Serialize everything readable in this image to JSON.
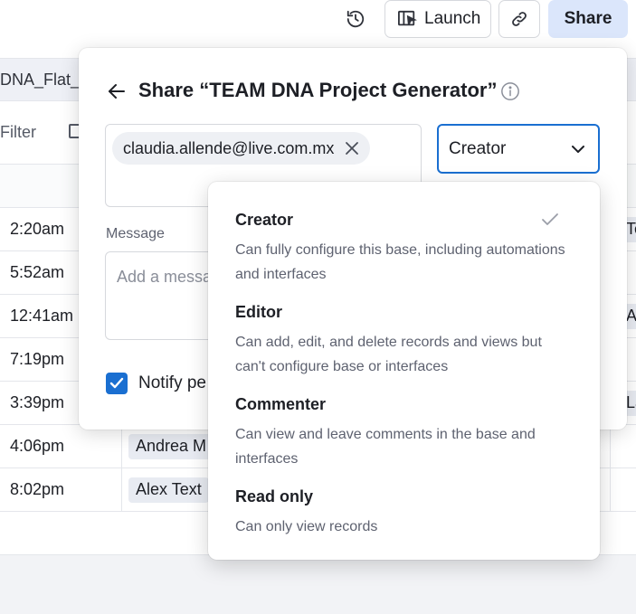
{
  "topbar": {
    "launch_label": "Launch",
    "share_label": "Share"
  },
  "background": {
    "tab_name": "DNA_Flat_",
    "filter_label": "Filter",
    "times": [
      "2:20am",
      "5:52am",
      "12:41am",
      "7:19pm",
      "3:39pm",
      "4:06pm",
      "8:02pm"
    ],
    "names": [
      "",
      "",
      "",
      "",
      "",
      "Andrea M",
      "Alex Text"
    ],
    "edge_chips": [
      "Te",
      "",
      "A",
      "",
      "La",
      "",
      ""
    ]
  },
  "dialog": {
    "title": "Share “TEAM DNA Project Generator”",
    "email_chip": "claudia.allende@live.com.mx",
    "role_selected": "Creator",
    "message_label": "Message",
    "message_placeholder": "Add a message",
    "notify_label": "Notify pe",
    "notify_checked": true
  },
  "role_menu": {
    "options": [
      {
        "title": "Creator",
        "description": "Can fully configure this base, including automations and interfaces",
        "selected": true
      },
      {
        "title": "Editor",
        "description": "Can add, edit, and delete records and views but can't configure base or interfaces",
        "selected": false
      },
      {
        "title": "Commenter",
        "description": "Can view and leave comments in the base and interfaces",
        "selected": false
      },
      {
        "title": "Read only",
        "description": "Can only view records",
        "selected": false
      }
    ]
  },
  "colors": {
    "accent": "#1a6fd1",
    "share_button_bg": "#dbe6fb",
    "chip_bg": "#e8ebf2"
  }
}
